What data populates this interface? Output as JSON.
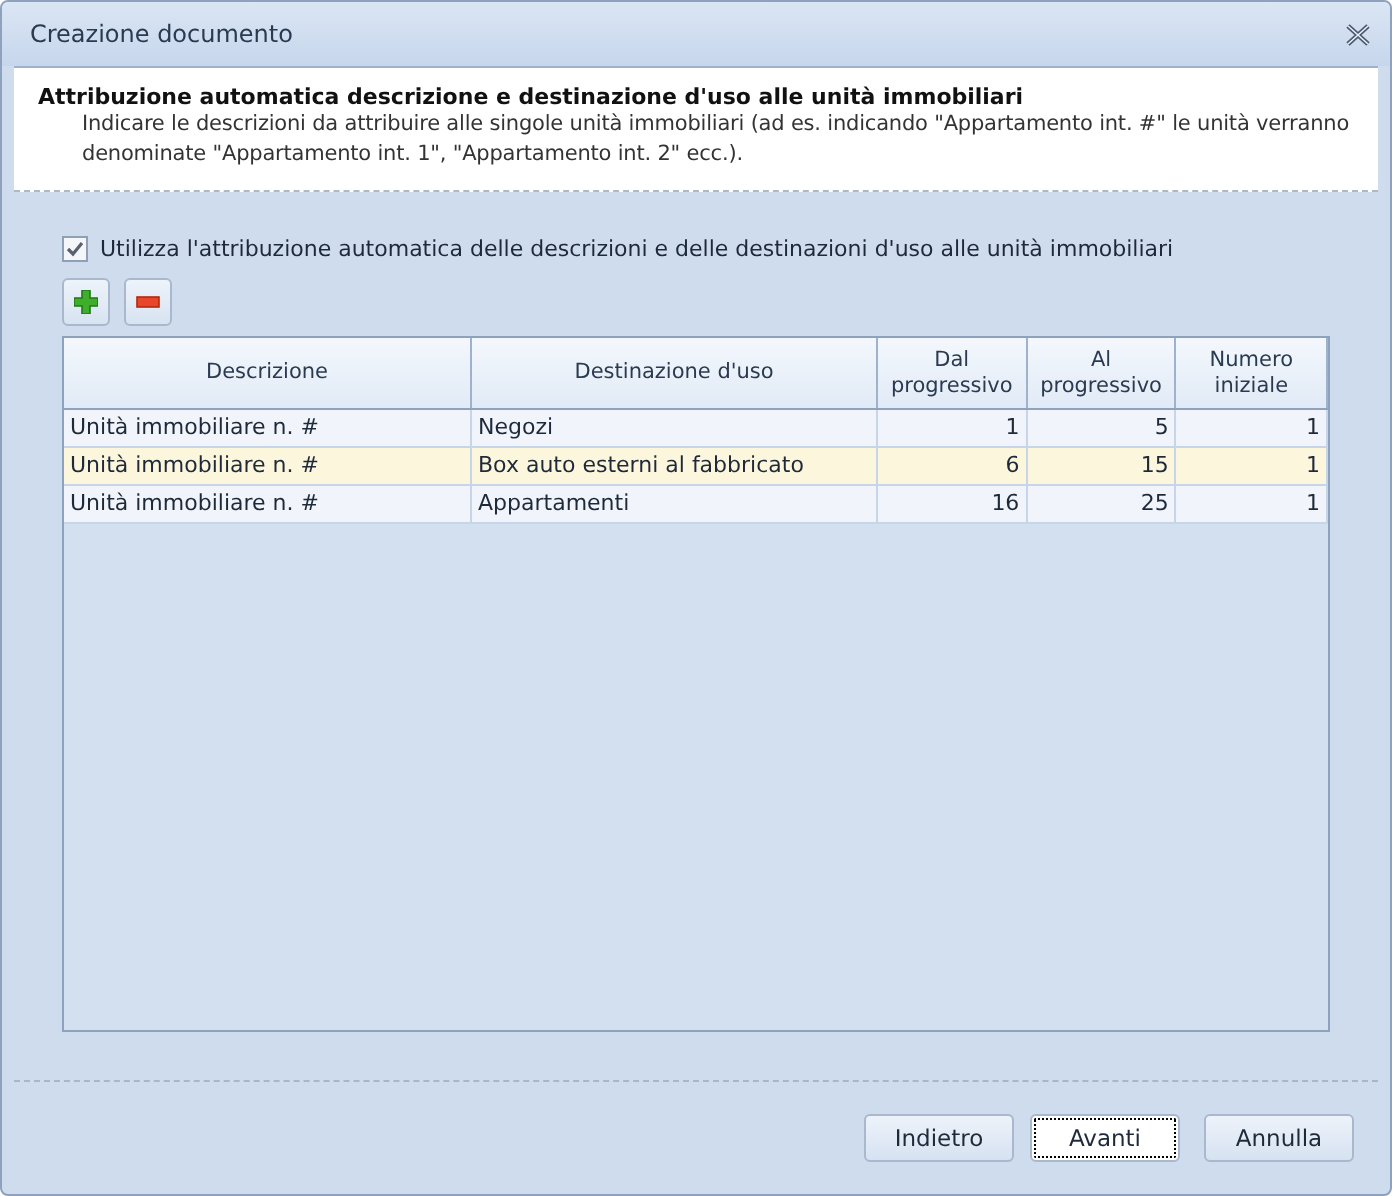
{
  "window": {
    "title": "Creazione documento"
  },
  "header": {
    "title": "Attribuzione automatica descrizione e destinazione d'uso alle unità immobiliari",
    "description": "Indicare le descrizioni da attribuire alle singole unità immobiliari (ad es. indicando \"Appartamento int. #\" le unità verranno denominate \"Appartamento int. 1\", \"Appartamento int. 2\" ecc.)."
  },
  "auto_option": {
    "label": "Utilizza l'attribuzione automatica delle descrizioni e delle destinazioni d'uso alle unità immobiliari",
    "checked": true
  },
  "table": {
    "columns": [
      "Descrizione",
      "Destinazione d'uso",
      "Dal progressivo",
      "Al progressivo",
      "Numero iniziale"
    ],
    "rows": [
      {
        "descrizione": "Unità immobiliare n. #",
        "destinazione": "Negozi",
        "dal": "1",
        "al": "5",
        "numero": "1",
        "selected": false
      },
      {
        "descrizione": "Unità immobiliare n. #",
        "destinazione": "Box auto esterni al fabbricato",
        "dal": "6",
        "al": "15",
        "numero": "1",
        "selected": true
      },
      {
        "descrizione": "Unità immobiliare n. #",
        "destinazione": "Appartamenti",
        "dal": "16",
        "al": "25",
        "numero": "1",
        "selected": false
      }
    ]
  },
  "buttons": [
    {
      "label": "Indietro",
      "focused": false
    },
    {
      "label": "Avanti",
      "focused": true
    },
    {
      "label": "Annulla",
      "focused": false
    }
  ]
}
